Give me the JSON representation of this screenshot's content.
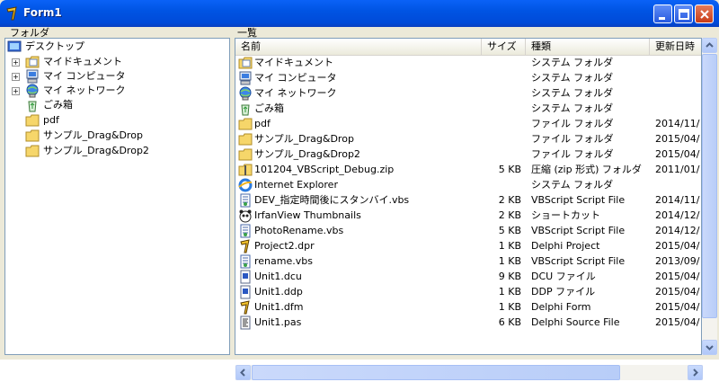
{
  "window": {
    "title": "Form1"
  },
  "folder_panel": {
    "label": "フォルダ",
    "items": [
      {
        "label": "デスクトップ",
        "icon": "desktop-icon",
        "expandable": false
      },
      {
        "label": "マイドキュメント",
        "icon": "my-documents-icon",
        "expandable": true
      },
      {
        "label": "マイ コンピュータ",
        "icon": "my-computer-icon",
        "expandable": true
      },
      {
        "label": "マイ ネットワーク",
        "icon": "my-network-icon",
        "expandable": true
      },
      {
        "label": "ごみ箱",
        "icon": "recycle-bin-icon",
        "expandable": false
      },
      {
        "label": "pdf",
        "icon": "folder-icon",
        "expandable": false
      },
      {
        "label": "サンプル_Drag&Drop",
        "icon": "folder-icon",
        "expandable": false
      },
      {
        "label": "サンプル_Drag&Drop2",
        "icon": "folder-icon",
        "expandable": false
      }
    ]
  },
  "list_panel": {
    "label": "一覧",
    "columns": {
      "name": "名前",
      "size": "サイズ",
      "type": "種類",
      "modified": "更新日時"
    },
    "rows": [
      {
        "name": "マイドキュメント",
        "size": "",
        "type": "システム フォルダ",
        "modified": "",
        "icon": "my-documents-icon"
      },
      {
        "name": "マイ コンピュータ",
        "size": "",
        "type": "システム フォルダ",
        "modified": "",
        "icon": "my-computer-icon"
      },
      {
        "name": "マイ ネットワーク",
        "size": "",
        "type": "システム フォルダ",
        "modified": "",
        "icon": "my-network-icon"
      },
      {
        "name": "ごみ箱",
        "size": "",
        "type": "システム フォルダ",
        "modified": "",
        "icon": "recycle-bin-icon"
      },
      {
        "name": "pdf",
        "size": "",
        "type": "ファイル フォルダ",
        "modified": "2014/11/",
        "icon": "folder-icon"
      },
      {
        "name": "サンプル_Drag&Drop",
        "size": "",
        "type": "ファイル フォルダ",
        "modified": "2015/04/",
        "icon": "folder-icon"
      },
      {
        "name": "サンプル_Drag&Drop2",
        "size": "",
        "type": "ファイル フォルダ",
        "modified": "2015/04/",
        "icon": "folder-icon"
      },
      {
        "name": "101204_VBScript_Debug.zip",
        "size": "5 KB",
        "type": "圧縮 (zip 形式) フォルダ",
        "modified": "2011/01/",
        "icon": "zip-icon"
      },
      {
        "name": "Internet Explorer",
        "size": "",
        "type": "システム フォルダ",
        "modified": "",
        "icon": "ie-icon"
      },
      {
        "name": "DEV_指定時間後にスタンバイ.vbs",
        "size": "2 KB",
        "type": "VBScript Script File",
        "modified": "2014/11/",
        "icon": "script-icon"
      },
      {
        "name": "IrfanView Thumbnails",
        "size": "2 KB",
        "type": "ショートカット",
        "modified": "2014/12/",
        "icon": "panda-icon"
      },
      {
        "name": "PhotoRename.vbs",
        "size": "5 KB",
        "type": "VBScript Script File",
        "modified": "2014/12/",
        "icon": "script-icon"
      },
      {
        "name": "Project2.dpr",
        "size": "1 KB",
        "type": "Delphi Project",
        "modified": "2015/04/",
        "icon": "delphi-icon"
      },
      {
        "name": "rename.vbs",
        "size": "1 KB",
        "type": "VBScript Script File",
        "modified": "2013/09/",
        "icon": "script-icon"
      },
      {
        "name": "Unit1.dcu",
        "size": "9 KB",
        "type": "DCU ファイル",
        "modified": "2015/04/",
        "icon": "file-icon"
      },
      {
        "name": "Unit1.ddp",
        "size": "1 KB",
        "type": "DDP ファイル",
        "modified": "2015/04/",
        "icon": "file-icon"
      },
      {
        "name": "Unit1.dfm",
        "size": "1 KB",
        "type": "Delphi Form",
        "modified": "2015/04/",
        "icon": "delphi-icon"
      },
      {
        "name": "Unit1.pas",
        "size": "6 KB",
        "type": "Delphi Source File",
        "modified": "2015/04/",
        "icon": "source-icon"
      }
    ]
  }
}
